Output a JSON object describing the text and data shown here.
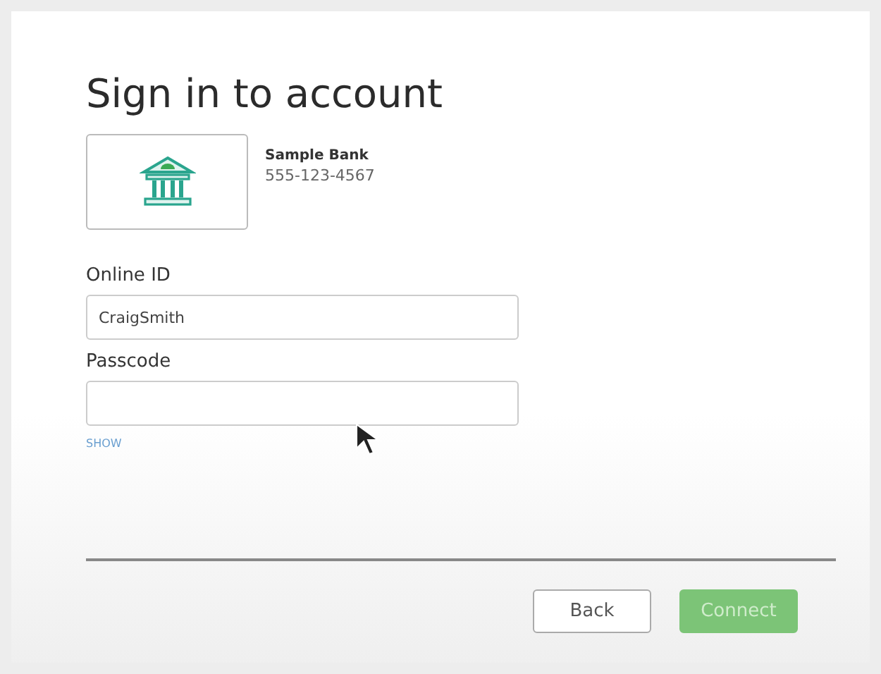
{
  "title": "Sign in to account",
  "bank": {
    "name": "Sample Bank",
    "phone": "555-123-4567"
  },
  "fields": [
    {
      "label": "Online ID",
      "value": "CraigSmith",
      "kind": "text"
    },
    {
      "label": "Passcode",
      "kind": "password"
    }
  ],
  "show_link": "SHOW",
  "buttons": [
    {
      "label": "Back",
      "kind": "secondary",
      "disabled": false
    },
    {
      "label": "Connect",
      "kind": "primary",
      "disabled": true
    }
  ]
}
